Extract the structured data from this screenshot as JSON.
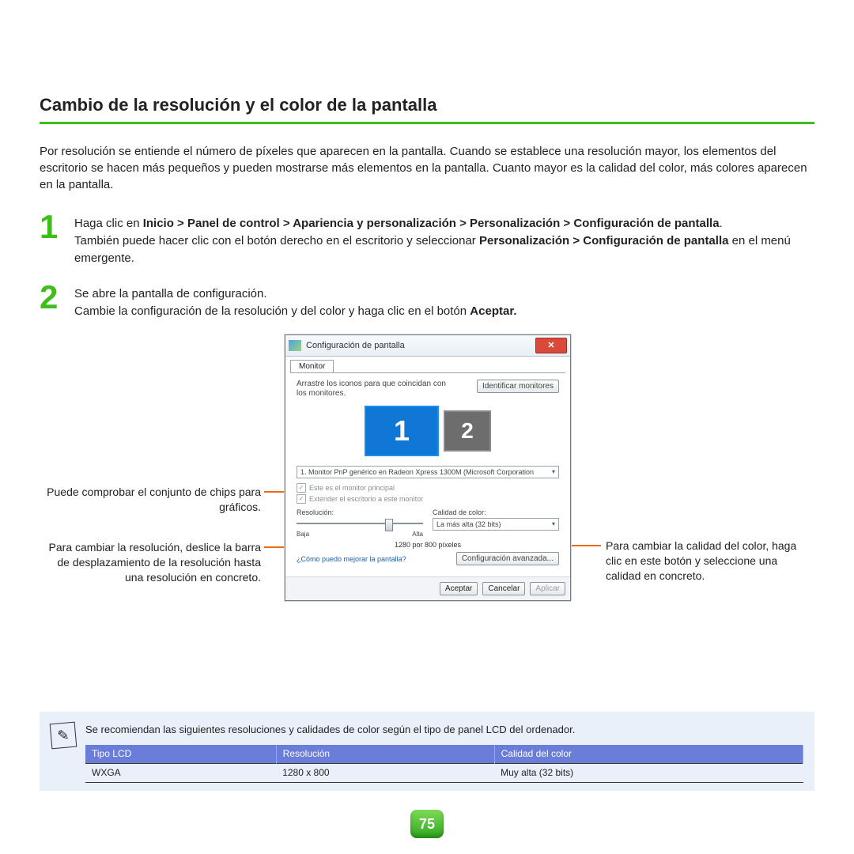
{
  "title": "Cambio de la resolución y el color de la pantalla",
  "intro": "Por resolución se entiende el número de píxeles que aparecen en la pantalla. Cuando se establece una resolución mayor, los elementos del escritorio se hacen más pequeños y pueden mostrarse más elementos en la pantalla. Cuanto mayor es la calidad del color, más colores aparecen en la pantalla.",
  "step1": {
    "pre": "Haga clic en ",
    "bold1": "Inicio > Panel de control > Apariencia y personalización > Personalización > Configuración de pantalla",
    "mid": ". También puede hacer clic con el botón derecho en el escritorio y seleccionar ",
    "bold2": "Personalización > Configuración de pantalla",
    "post": " en el menú emergente."
  },
  "step2": {
    "line1": "Se abre la pantalla de configuración.",
    "line2a": "Cambie la configuración de la resolución y del color y haga clic en el botón ",
    "line2b": "Aceptar."
  },
  "callouts": {
    "chips": "Puede comprobar el conjunto de chips para gráficos.",
    "res": "Para cambiar la resolución, deslice la barra de desplazamiento de la resolución hasta una resolución en concreto.",
    "color": "Para cambiar la calidad del color, haga clic en este botón y seleccione una calidad en concreto."
  },
  "dialog": {
    "title": "Configuración de pantalla",
    "tab": "Monitor",
    "drag": "Arrastre los iconos para que coincidan con los monitores.",
    "identify": "Identificar monitores",
    "mon1": "1",
    "mon2": "2",
    "monitor_dd": "1. Monitor PnP genérico en Radeon Xpress 1300M (Microsoft Corporation",
    "chk1": "Este es el monitor principal",
    "chk2": "Extender el escritorio a este monitor",
    "res_label": "Resolución:",
    "low": "Baja",
    "high": "Alta",
    "res_value": "1280 por 800 píxeles",
    "color_label": "Calidad de color:",
    "color_value": "La más alta (32 bits)",
    "link": "¿Cómo puedo mejorar la pantalla?",
    "adv": "Configuración avanzada...",
    "ok": "Aceptar",
    "cancel": "Cancelar",
    "apply": "Aplicar"
  },
  "note": {
    "text": "Se recomiendan las siguientes resoluciones y calidades de color según el tipo de panel LCD del ordenador.",
    "headers": {
      "lcd": "Tipo LCD",
      "res": "Resolución",
      "color": "Calidad del color"
    },
    "row": {
      "lcd": "WXGA",
      "res": "1280 x 800",
      "color": "Muy alta (32 bits)"
    }
  },
  "page_number": "75"
}
